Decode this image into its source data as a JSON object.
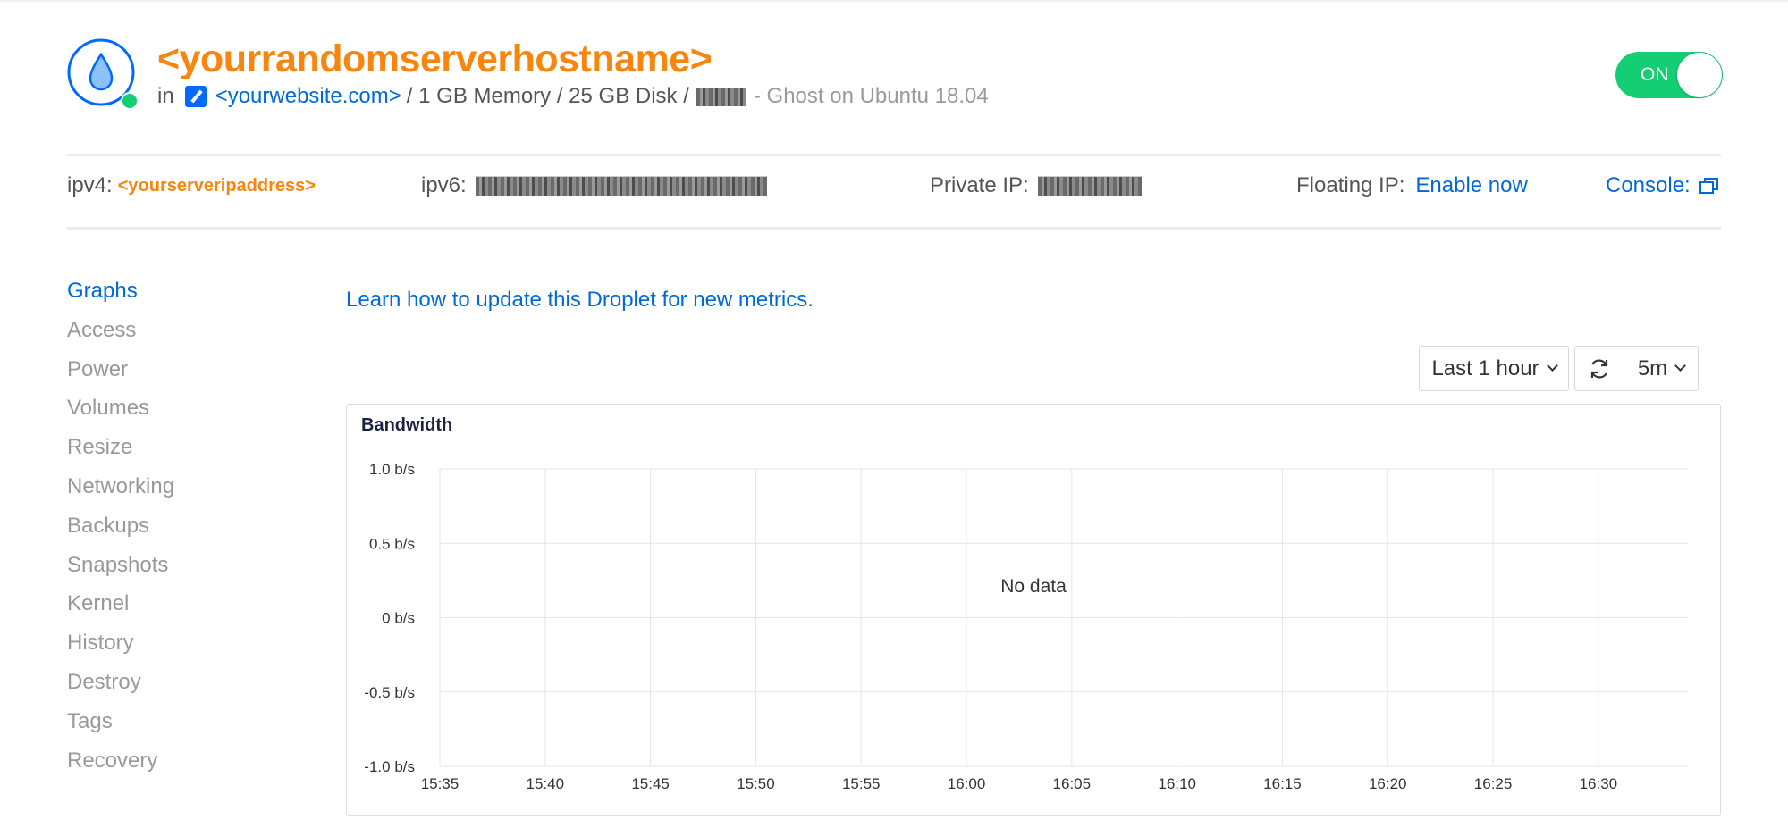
{
  "header": {
    "hostname": "<yourrandomserverhostname>",
    "in_label": "in",
    "project_link": "<yourwebsite.com>",
    "specs": "/ 1 GB Memory / 25 GB Disk /",
    "image_text": "- Ghost on Ubuntu 18.04",
    "status_dot_color": "#15cd72",
    "power_toggle_label": "ON"
  },
  "ip_bar": {
    "ipv4_label": "ipv4:",
    "ipv4_value": "<yourserveripaddress>",
    "ipv6_label": "ipv6:",
    "private_ip_label": "Private IP:",
    "floating_ip_label": "Floating IP:",
    "floating_ip_action": "Enable now",
    "console_label": "Console:"
  },
  "sidebar": {
    "items": [
      {
        "label": "Graphs",
        "active": true
      },
      {
        "label": "Access"
      },
      {
        "label": "Power"
      },
      {
        "label": "Volumes"
      },
      {
        "label": "Resize"
      },
      {
        "label": "Networking"
      },
      {
        "label": "Backups"
      },
      {
        "label": "Snapshots"
      },
      {
        "label": "Kernel"
      },
      {
        "label": "History"
      },
      {
        "label": "Destroy"
      },
      {
        "label": "Tags"
      },
      {
        "label": "Recovery"
      }
    ]
  },
  "main": {
    "learn_link": "Learn how to update this Droplet for new metrics.",
    "time_range": "Last 1 hour",
    "interval": "5m"
  },
  "colors": {
    "accent_blue": "#0069d9",
    "brand_orange": "#f7860f",
    "on_green": "#15cd72"
  },
  "chart_data": {
    "type": "line",
    "title": "Bandwidth",
    "empty_message": "No data",
    "y_ticks": [
      "1.0 b/s",
      "0.5 b/s",
      "0 b/s",
      "-0.5 b/s",
      "-1.0 b/s"
    ],
    "x_ticks": [
      "15:35",
      "15:40",
      "15:45",
      "15:50",
      "15:55",
      "16:00",
      "16:05",
      "16:10",
      "16:15",
      "16:20",
      "16:25",
      "16:30"
    ],
    "ylim": [
      -1.0,
      1.0
    ],
    "series": [],
    "grid": true
  }
}
